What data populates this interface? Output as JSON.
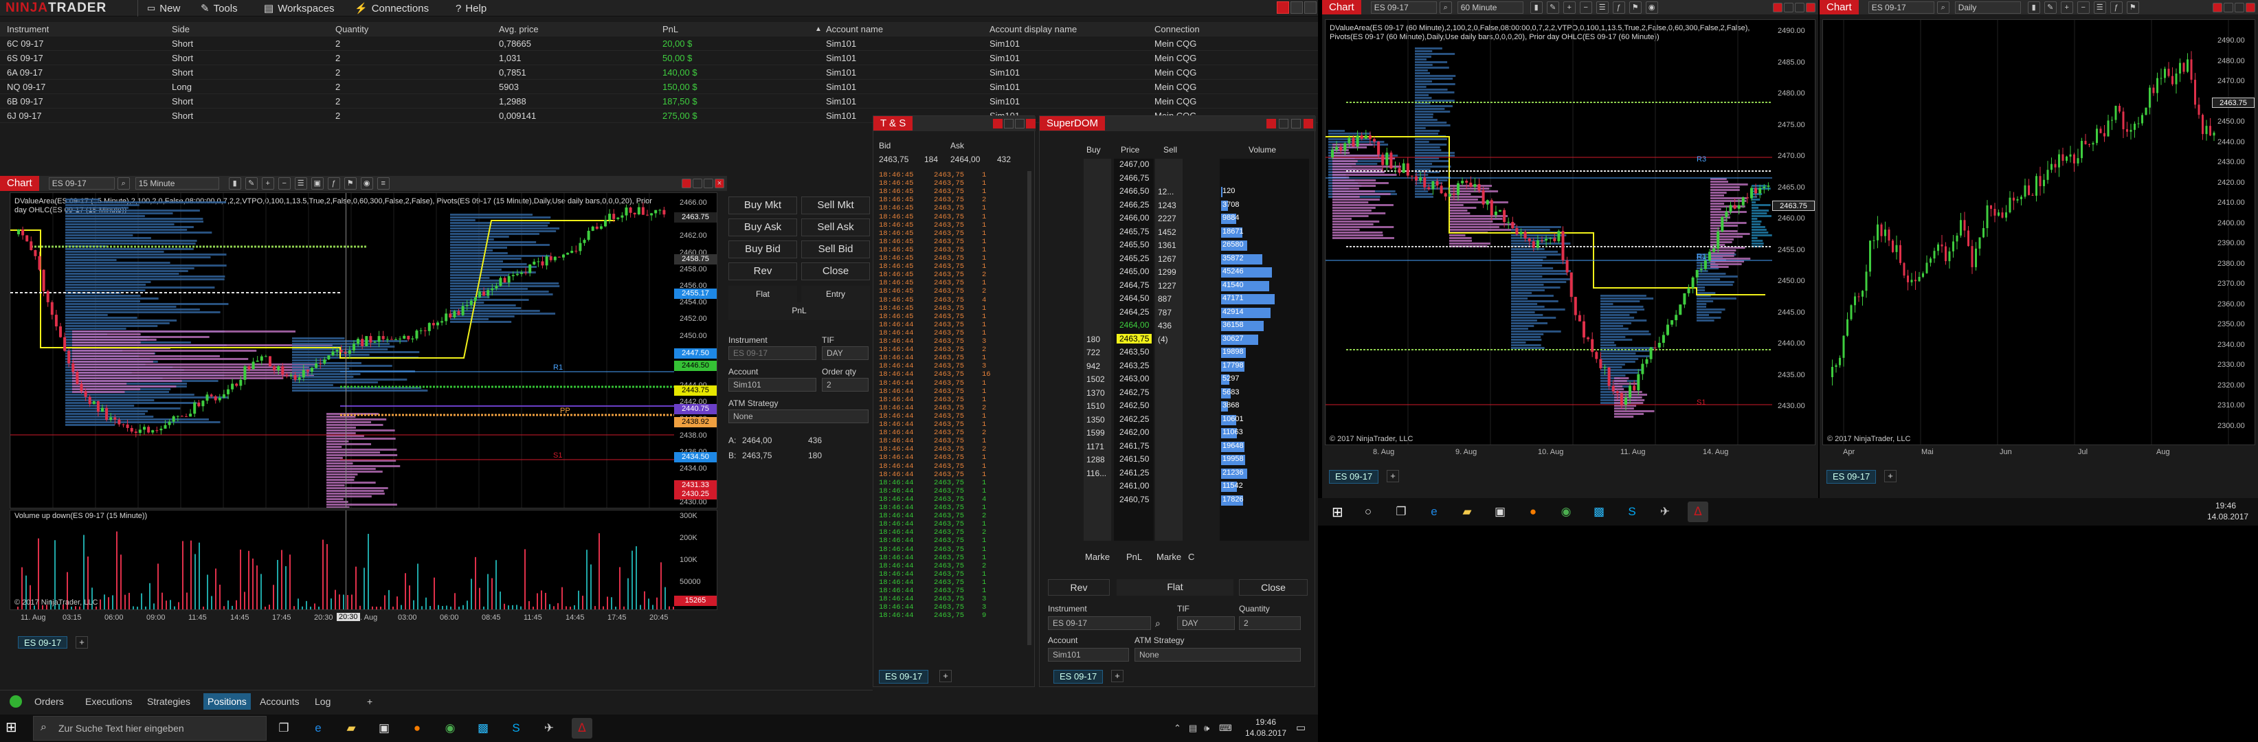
{
  "app": {
    "logo_prefix": "NINJA",
    "logo_suffix": "TRADER",
    "menu": [
      "New",
      "Tools",
      "Workspaces",
      "Connections",
      "Help"
    ]
  },
  "positions": {
    "columns": [
      "Instrument",
      "Side",
      "Quantity",
      "Avg. price",
      "PnL",
      "Account name",
      "Account display name",
      "Connection"
    ],
    "rows": [
      {
        "instrument": "6C 09-17",
        "side": "Short",
        "qty": "2",
        "avg": "0,78665",
        "pnl": "20,00 $",
        "account": "Sim101",
        "display": "Sim101",
        "conn": "Mein CQG"
      },
      {
        "instrument": "6S 09-17",
        "side": "Short",
        "qty": "2",
        "avg": "1,031",
        "pnl": "50,00 $",
        "account": "Sim101",
        "display": "Sim101",
        "conn": "Mein CQG"
      },
      {
        "instrument": "6A 09-17",
        "side": "Short",
        "qty": "2",
        "avg": "0,7851",
        "pnl": "140,00 $",
        "account": "Sim101",
        "display": "Sim101",
        "conn": "Mein CQG"
      },
      {
        "instrument": "NQ 09-17",
        "side": "Long",
        "qty": "2",
        "avg": "5903",
        "pnl": "150,00 $",
        "account": "Sim101",
        "display": "Sim101",
        "conn": "Mein CQG"
      },
      {
        "instrument": "6B 09-17",
        "side": "Short",
        "qty": "2",
        "avg": "1,2988",
        "pnl": "187,50 $",
        "account": "Sim101",
        "display": "Sim101",
        "conn": "Mein CQG"
      },
      {
        "instrument": "6J 09-17",
        "side": "Short",
        "qty": "2",
        "avg": "0,009141",
        "pnl": "275,00 $",
        "account": "Sim101",
        "display": "Sim101",
        "conn": "Mein CQG"
      }
    ]
  },
  "chart1": {
    "tab": "Chart",
    "instrument": "ES 09-17",
    "interval": "15 Minute",
    "indicator_text": "DValueArea(ES 09-17 (15 Minute),2,100,2,0,False,08:00:00,0,7,2,2,VTPO,0,100,1,13.5,True,2,False,0,60,300,False,2,False), Pivots(ES 09-17 (15 Minute),Daily,Use daily bars,0,0,0,20), Prior day OHLC(ES 09-17 (15 Minute))",
    "volume_label": "Volume up down(ES 09-17 (15 Minute))",
    "copyright": "© 2017 NinjaTrader, LLC",
    "price_ticks": [
      "2466.00",
      "2464.00",
      "2462.00",
      "2460.00",
      "2458.00",
      "2456.00",
      "2454.00",
      "2452.00",
      "2450.00",
      "2448.00",
      "2446.00",
      "2444.00",
      "2442.00",
      "2440.00",
      "2438.00",
      "2436.00",
      "2434.00",
      "2432.00",
      "2430.00"
    ],
    "vol_ticks": [
      "300K",
      "200K",
      "100K",
      "50000"
    ],
    "time_ticks": [
      "11. Aug",
      "03:15",
      "06:00",
      "09:00",
      "11:45",
      "14:45",
      "17:45",
      "20:30",
      "3. Aug",
      "03:00",
      "06:00",
      "08:45",
      "11:45",
      "14:45",
      "17:45",
      "20:45"
    ],
    "tags": [
      {
        "text": "2463.75",
        "color": "#ffffff",
        "bg": "#222"
      },
      {
        "text": "2458.75",
        "color": "#ffffff",
        "bg": "#333"
      },
      {
        "text": "2455.17",
        "color": "#ffffff",
        "bg": "#1e88e5"
      },
      {
        "text": "2447.50",
        "color": "#ffffff",
        "bg": "#1e88e5"
      },
      {
        "text": "2446.50",
        "color": "#000000",
        "bg": "#35c135"
      },
      {
        "text": "2443.75",
        "color": "#000000",
        "bg": "#e6e600"
      },
      {
        "text": "2440.75",
        "color": "#ffffff",
        "bg": "#6a3fc7"
      },
      {
        "text": "2438.92",
        "color": "#000000",
        "bg": "#f0a040"
      },
      {
        "text": "2434.50",
        "color": "#ffffff",
        "bg": "#1e88e5"
      },
      {
        "text": "2431.33",
        "color": "#ffffff",
        "bg": "#d11a2a"
      },
      {
        "text": "2430.25",
        "color": "#ffffff",
        "bg": "#d11a2a"
      },
      {
        "text": "15265",
        "color": "#ffffff",
        "bg": "#d11a2a"
      }
    ],
    "crosshair_time": "20:30",
    "level_labels": [
      "R1",
      "PP"
    ],
    "s1": "S1",
    "bottom_tab": "ES 09-17"
  },
  "order_panel": {
    "buy_mkt": "Buy Mkt",
    "sell_mkt": "Sell Mkt",
    "buy_ask": "Buy Ask",
    "sell_ask": "Sell Ask",
    "buy_bid": "Buy Bid",
    "sell_bid": "Sell Bid",
    "rev": "Rev",
    "close": "Close",
    "flat": "Flat",
    "entry": "Entry",
    "pnl": "PnL",
    "instrument_label": "Instrument",
    "instrument_value": "ES 09-17",
    "tif_label": "TIF",
    "tif_value": "DAY",
    "account_label": "Account",
    "account_value": "Sim101",
    "qty_label": "Order qty",
    "qty_value": "2",
    "atm_label": "ATM Strategy",
    "atm_value": "None",
    "a_label": "A:",
    "a_price": "2464,00",
    "a_size": "436",
    "b_label": "B:",
    "b_price": "2463,75",
    "b_size": "180"
  },
  "ts": {
    "title": "T & S",
    "bid_label": "Bid",
    "ask_label": "Ask",
    "bid_price": "2463,75",
    "bid_size": "184",
    "ask_price": "2464,00",
    "ask_size": "432",
    "bottom_tab": "ES 09-17",
    "rows_orange": [
      [
        "18:46:45",
        "2463,75",
        "1"
      ],
      [
        "18:46:45",
        "2463,75",
        "1"
      ],
      [
        "18:46:45",
        "2463,75",
        "1"
      ],
      [
        "18:46:45",
        "2463,75",
        "2"
      ],
      [
        "18:46:45",
        "2463,75",
        "1"
      ],
      [
        "18:46:45",
        "2463,75",
        "1"
      ],
      [
        "18:46:45",
        "2463,75",
        "1"
      ],
      [
        "18:46:45",
        "2463,75",
        "1"
      ],
      [
        "18:46:45",
        "2463,75",
        "1"
      ],
      [
        "18:46:45",
        "2463,75",
        "1"
      ],
      [
        "18:46:45",
        "2463,75",
        "1"
      ],
      [
        "18:46:45",
        "2463,75",
        "1"
      ],
      [
        "18:46:45",
        "2463,75",
        "2"
      ],
      [
        "18:46:45",
        "2463,75",
        "1"
      ],
      [
        "18:46:45",
        "2463,75",
        "2"
      ],
      [
        "18:46:45",
        "2463,75",
        "4"
      ],
      [
        "18:46:45",
        "2463,75",
        "1"
      ],
      [
        "18:46:45",
        "2463,75",
        "1"
      ],
      [
        "18:46:44",
        "2463,75",
        "1"
      ],
      [
        "18:46:44",
        "2463,75",
        "1"
      ],
      [
        "18:46:44",
        "2463,75",
        "3"
      ],
      [
        "18:46:44",
        "2463,75",
        "2"
      ],
      [
        "18:46:44",
        "2463,75",
        "1"
      ],
      [
        "18:46:44",
        "2463,75",
        "3"
      ],
      [
        "18:46:44",
        "2463,75",
        "16"
      ],
      [
        "18:46:44",
        "2463,75",
        "1"
      ],
      [
        "18:46:44",
        "2463,75",
        "1"
      ],
      [
        "18:46:44",
        "2463,75",
        "1"
      ],
      [
        "18:46:44",
        "2463,75",
        "2"
      ],
      [
        "18:46:44",
        "2463,75",
        "1"
      ],
      [
        "18:46:44",
        "2463,75",
        "1"
      ],
      [
        "18:46:44",
        "2463,75",
        "2"
      ],
      [
        "18:46:44",
        "2463,75",
        "1"
      ],
      [
        "18:46:44",
        "2463,75",
        "2"
      ],
      [
        "18:46:44",
        "2463,75",
        "1"
      ],
      [
        "18:46:44",
        "2463,75",
        "1"
      ],
      [
        "18:46:44",
        "2463,75",
        "1"
      ]
    ],
    "rows_green": [
      [
        "18:46:44",
        "2463,75",
        "1"
      ],
      [
        "18:46:44",
        "2463,75",
        "1"
      ],
      [
        "18:46:44",
        "2463,75",
        "4"
      ],
      [
        "18:46:44",
        "2463,75",
        "1"
      ],
      [
        "18:46:44",
        "2463,75",
        "2"
      ],
      [
        "18:46:44",
        "2463,75",
        "1"
      ],
      [
        "18:46:44",
        "2463,75",
        "2"
      ],
      [
        "18:46:44",
        "2463,75",
        "1"
      ],
      [
        "18:46:44",
        "2463,75",
        "1"
      ],
      [
        "18:46:44",
        "2463,75",
        "1"
      ],
      [
        "18:46:44",
        "2463,75",
        "2"
      ],
      [
        "18:46:44",
        "2463,75",
        "1"
      ],
      [
        "18:46:44",
        "2463,75",
        "1"
      ],
      [
        "18:46:44",
        "2463,75",
        "1"
      ],
      [
        "18:46:44",
        "2463,75",
        "3"
      ],
      [
        "18:46:44",
        "2463,75",
        "3"
      ],
      [
        "18:46:44",
        "2463,75",
        "9"
      ]
    ]
  },
  "superdom": {
    "title": "SuperDOM",
    "col_buy": "Buy",
    "col_price": "Price",
    "col_sell": "Sell",
    "col_volume": "Volume",
    "rows": [
      {
        "buy": "",
        "price": "2467,00",
        "sell": "",
        "vol": "",
        "vpct": 0
      },
      {
        "buy": "",
        "price": "2466,75",
        "sell": "",
        "vol": "",
        "vpct": 0
      },
      {
        "buy": "",
        "price": "2466,50",
        "sell": "12...",
        "vol": "120",
        "vpct": 2
      },
      {
        "buy": "",
        "price": "2466,25",
        "sell": "1243",
        "vol": "3708",
        "vpct": 8
      },
      {
        "buy": "",
        "price": "2466,00",
        "sell": "2227",
        "vol": "9884",
        "vpct": 18
      },
      {
        "buy": "",
        "price": "2465,75",
        "sell": "1452",
        "vol": "18671",
        "vpct": 26
      },
      {
        "buy": "",
        "price": "2465,50",
        "sell": "1361",
        "vol": "26580",
        "vpct": 32
      },
      {
        "buy": "",
        "price": "2465,25",
        "sell": "1267",
        "vol": "35872",
        "vpct": 50
      },
      {
        "buy": "",
        "price": "2465,00",
        "sell": "1299",
        "vol": "45246",
        "vpct": 62
      },
      {
        "buy": "",
        "price": "2464,75",
        "sell": "1227",
        "vol": "41540",
        "vpct": 58
      },
      {
        "buy": "",
        "price": "2464,50",
        "sell": "887",
        "vol": "47171",
        "vpct": 65
      },
      {
        "buy": "",
        "price": "2464,25",
        "sell": "787",
        "vol": "42914",
        "vpct": 60
      },
      {
        "buy": "",
        "price": "2464,00",
        "sell": "436",
        "vol": "36158",
        "vpct": 52
      },
      {
        "buy": "180",
        "price": "2463,75",
        "sell": "(4)",
        "vol": "30627",
        "vpct": 45
      },
      {
        "buy": "722",
        "price": "2463,50",
        "sell": "",
        "vol": "19898",
        "vpct": 30
      },
      {
        "buy": "942",
        "price": "2463,25",
        "sell": "",
        "vol": "17798",
        "vpct": 28
      },
      {
        "buy": "1502",
        "price": "2463,00",
        "sell": "",
        "vol": "5297",
        "vpct": 10
      },
      {
        "buy": "1370",
        "price": "2462,75",
        "sell": "",
        "vol": "5683",
        "vpct": 12
      },
      {
        "buy": "1510",
        "price": "2462,50",
        "sell": "",
        "vol": "3868",
        "vpct": 8
      },
      {
        "buy": "1350",
        "price": "2462,25",
        "sell": "",
        "vol": "10601",
        "vpct": 18
      },
      {
        "buy": "1599",
        "price": "2462,00",
        "sell": "",
        "vol": "11063",
        "vpct": 19
      },
      {
        "buy": "1171",
        "price": "2461,75",
        "sell": "",
        "vol": "19648",
        "vpct": 28
      },
      {
        "buy": "1288",
        "price": "2461,50",
        "sell": "",
        "vol": "19958",
        "vpct": 29
      },
      {
        "buy": "116...",
        "price": "2461,25",
        "sell": "",
        "vol": "21236",
        "vpct": 32
      },
      {
        "buy": "",
        "price": "2461,00",
        "sell": "",
        "vol": "11542",
        "vpct": 19
      },
      {
        "buy": "",
        "price": "2460,75",
        "sell": "",
        "vol": "17826",
        "vpct": 27
      }
    ],
    "footer_marke": "Marke",
    "footer_pnl": "PnL",
    "footer_marke2": "Marke",
    "footer_c": "C",
    "rev": "Rev",
    "flat": "Flat",
    "close": "Close",
    "instrument_label": "Instrument",
    "instrument_value": "ES 09-17",
    "tif_label": "TIF",
    "tif_value": "DAY",
    "qty_label": "Quantity",
    "qty_value": "2",
    "account_label": "Account",
    "account_value": "Sim101",
    "atm_label": "ATM Strategy",
    "atm_value": "None",
    "bottom_tab": "ES 09-17"
  },
  "bottom_tabs": [
    "Orders",
    "Executions",
    "Strategies",
    "Positions",
    "Accounts",
    "Log"
  ],
  "taskbar_left": {
    "search_placeholder": "Zur Suche Text hier eingeben",
    "time": "19:46",
    "date": "14.08.2017"
  },
  "chart2": {
    "tab": "Chart",
    "instrument": "ES 09-17",
    "interval": "60 Minute",
    "indicator_text": "DValueArea(ES 09-17 (60 Minute),2,100,2,0,False,08:00:00,0,7,2,2,VTPO,0,100,1,13.5,True,2,False,0,60,300,False,2,False), Pivots(ES 09-17 (60 Minute),Daily,Use daily bars,0,0,0,20), Prior day OHLC(ES 09-17 (60 Minute))",
    "copyright": "© 2017 NinjaTrader, LLC",
    "price_ticks": [
      "2490.00",
      "2485.00",
      "2480.00",
      "2475.00",
      "2470.00",
      "2465.00",
      "2460.00",
      "2455.00",
      "2450.00",
      "2445.00",
      "2440.00",
      "2435.00",
      "2430.00"
    ],
    "tag": "2463.75",
    "time_ticks": [
      "8. Aug",
      "9. Aug",
      "10. Aug",
      "11. Aug",
      "14. Aug"
    ],
    "labels": [
      "R3",
      "R2",
      "R1",
      "S1"
    ],
    "bottom_tab": "ES 09-17"
  },
  "chart3": {
    "tab": "Chart",
    "instrument": "ES 09-17",
    "interval": "Daily",
    "copyright": "© 2017 NinjaTrader, LLC",
    "price_ticks": [
      "2490.00",
      "2480.00",
      "2470.00",
      "2460.00",
      "2450.00",
      "2440.00",
      "2430.00",
      "2420.00",
      "2410.00",
      "2400.00",
      "2390.00",
      "2380.00",
      "2370.00",
      "2360.00",
      "2350.00",
      "2340.00",
      "2330.00",
      "2320.00",
      "2310.00",
      "2300.00"
    ],
    "tag": "2463.75",
    "time_ticks": [
      "Apr",
      "Mai",
      "Jun",
      "Jul",
      "Aug"
    ],
    "bottom_tab": "ES 09-17"
  },
  "taskbar_right": {
    "time": "19:46",
    "date": "14.08.2017"
  },
  "colors": {
    "accent_red": "#c9181e",
    "green": "#3fce3f",
    "blue": "#4f8ee3",
    "yellow": "#f2f21a"
  }
}
